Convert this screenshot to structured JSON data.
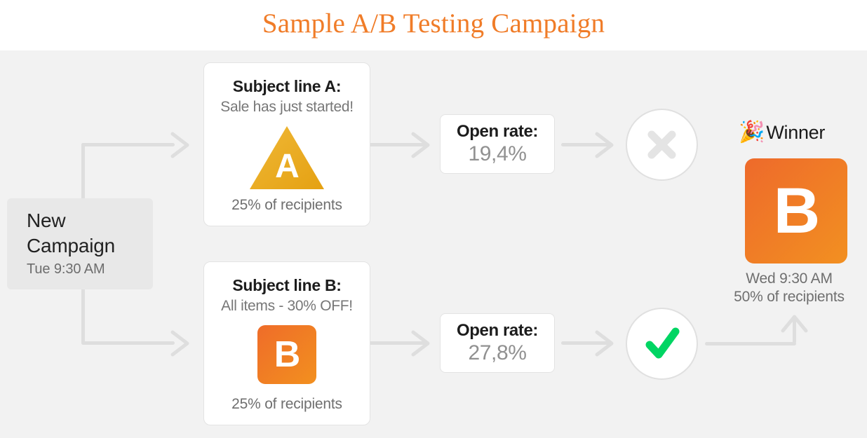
{
  "header": {
    "title": "Sample A/B Testing Campaign",
    "title_color": "#f07c28"
  },
  "campaign": {
    "name_line1": "New",
    "name_line2": "Campaign",
    "time": "Tue 9:30 AM"
  },
  "variants": [
    {
      "heading": "Subject line A:",
      "subject": "Sale has just started!",
      "badge_letter": "A",
      "badge_shape": "triangle",
      "badge_color": "#eeb02a",
      "recipients": "25% of recipients",
      "rate_label": "Open rate:",
      "rate_value": "19,4%",
      "result_icon": "cross-icon",
      "result_color": "#e4e4e4"
    },
    {
      "heading": "Subject line B:",
      "subject": "All items - 30% OFF!",
      "badge_letter": "B",
      "badge_shape": "rounded-square",
      "badge_color": "#ef7a24",
      "recipients": "25% of recipients",
      "rate_label": "Open rate:",
      "rate_value": "27,8%",
      "result_icon": "check-icon",
      "result_color": "#00d563"
    }
  ],
  "winner": {
    "icon": "party-popper-icon",
    "icon_glyph": "🎉",
    "label": "Winner",
    "letter": "B",
    "tile_color": "#ef7a24",
    "time": "Wed 9:30 AM",
    "recipients": "50% of recipients"
  }
}
